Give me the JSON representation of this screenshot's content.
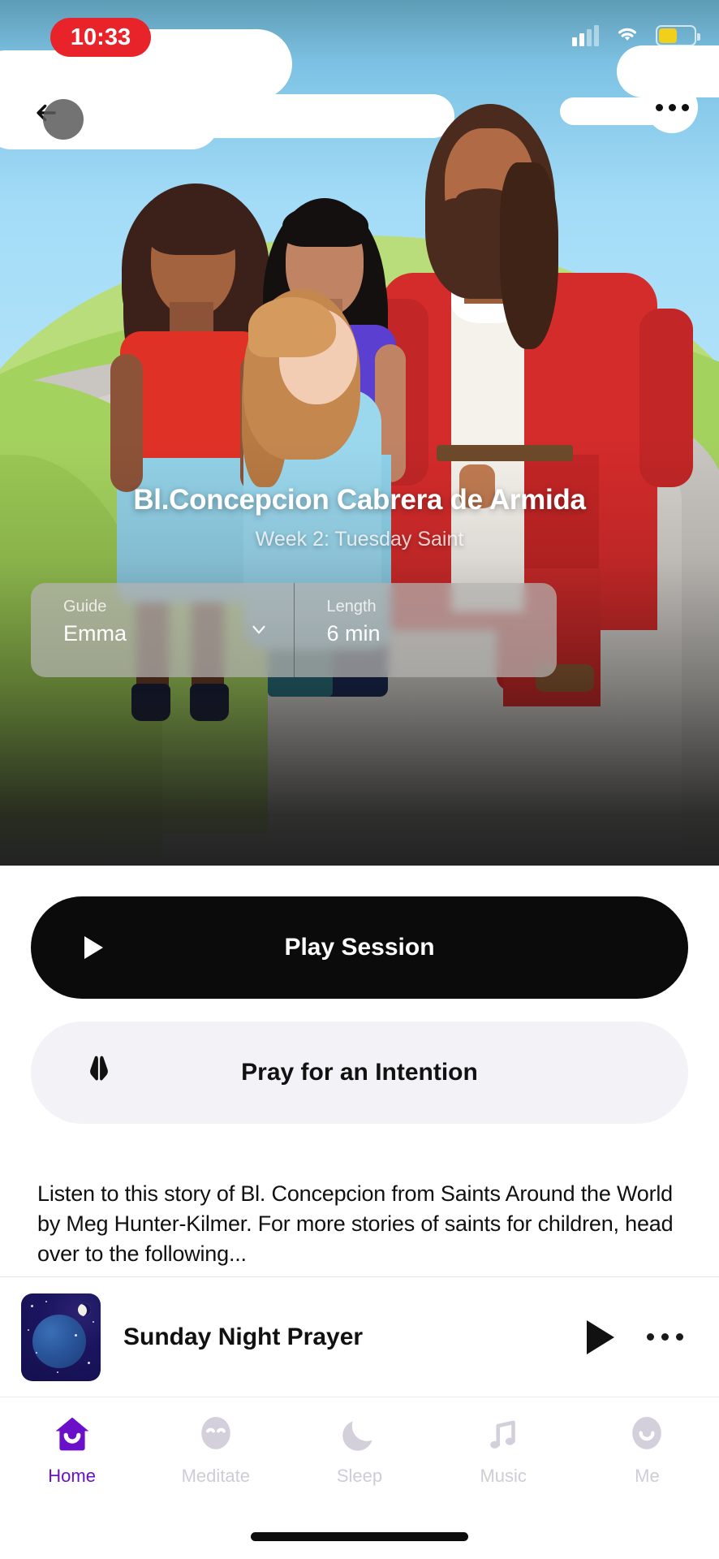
{
  "status_bar": {
    "time": "10:33",
    "time_pill_color": "#e8242a",
    "signal_icon": "cellular-signal-icon",
    "wifi_icon": "wifi-icon",
    "battery_icon": "battery-low-power-icon",
    "battery_color": "#f2cf1b"
  },
  "hero": {
    "back_icon": "back-arrow-icon",
    "more_icon": "more-options-icon",
    "title": "Bl.Concepcion Cabrera de Armida",
    "subtitle": "Week 2: Tuesday Saint",
    "illustration": "jesus-walking-with-children-illustration",
    "selector": {
      "guide": {
        "label": "Guide",
        "value": "Emma",
        "chevron_icon": "chevron-down-icon"
      },
      "length": {
        "label": "Length",
        "value": "6 min"
      }
    }
  },
  "actions": {
    "play": {
      "label": "Play Session",
      "icon": "play-triangle-icon",
      "bg_color": "#0b0b0b"
    },
    "pray": {
      "label": "Pray for an Intention",
      "icon": "praying-hands-icon",
      "bg_color": "#f3f2f7"
    }
  },
  "description": "Listen to this story of Bl. Concepcion from Saints Around the World by Meg Hunter-Kilmer. For more stories of saints for children, head over to the following...",
  "mini_player": {
    "thumbnail": "night-sky-planet-thumbnail",
    "title": "Sunday Night Prayer",
    "play_icon": "play-triangle-icon",
    "more_icon": "more-options-icon"
  },
  "tabbar": {
    "accent_color": "#6a10c9",
    "inactive_color": "#cfccd6",
    "items": [
      {
        "label": "Home",
        "icon": "home-house-smile-icon",
        "active": true
      },
      {
        "label": "Meditate",
        "icon": "meditate-face-icon",
        "active": false
      },
      {
        "label": "Sleep",
        "icon": "crescent-moon-icon",
        "active": false
      },
      {
        "label": "Music",
        "icon": "music-note-icon",
        "active": false
      },
      {
        "label": "Me",
        "icon": "profile-face-icon",
        "active": false
      }
    ]
  },
  "home_indicator": "home-indicator-bar"
}
